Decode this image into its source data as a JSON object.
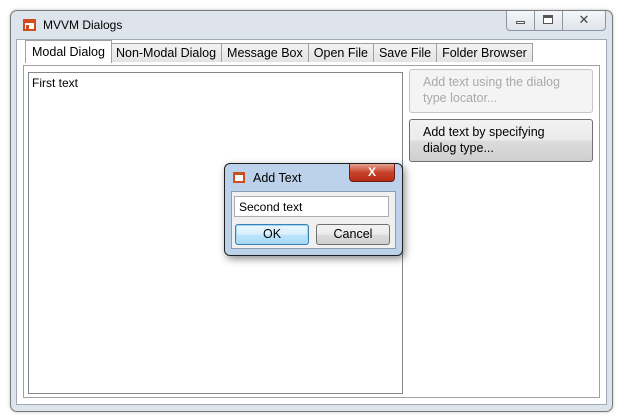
{
  "window": {
    "title": "MVVM Dialogs",
    "icon": "app-window-icon",
    "caption_buttons": [
      "minimize",
      "maximize",
      "close"
    ]
  },
  "tabs": [
    {
      "label": "Modal Dialog",
      "selected": true
    },
    {
      "label": "Non-Modal Dialog",
      "selected": false
    },
    {
      "label": "Message Box",
      "selected": false
    },
    {
      "label": "Open File",
      "selected": false
    },
    {
      "label": "Save File",
      "selected": false
    },
    {
      "label": "Folder Browser",
      "selected": false
    }
  ],
  "modal_tab": {
    "text_list": [
      "First text"
    ],
    "buttons": [
      {
        "label": "Add text using the dialog type locator...",
        "enabled": false
      },
      {
        "label": "Add text by specifying dialog type...",
        "enabled": true
      }
    ]
  },
  "dialog": {
    "title": "Add Text",
    "close_glyph": "X",
    "input_value": "Second text",
    "ok_label": "OK",
    "cancel_label": "Cancel"
  },
  "colors": {
    "accent_icon": "#d24b1d",
    "window_frame": "#dee4ec",
    "dialog_frame": "#bcd2ea",
    "close_button": "#c7432b"
  }
}
